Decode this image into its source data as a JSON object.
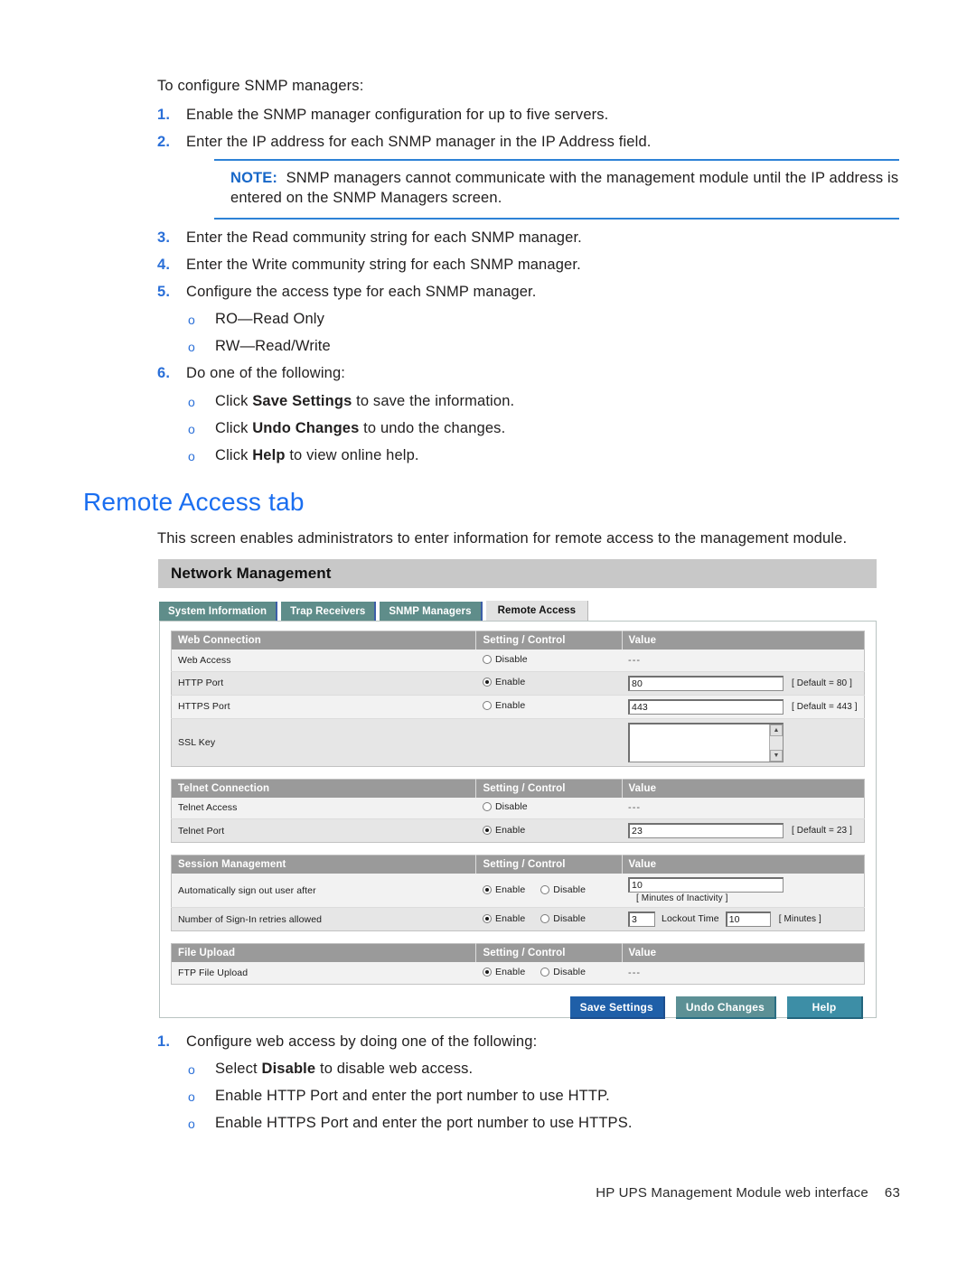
{
  "document": {
    "lead_in": "To configure SNMP managers:",
    "steps_top": [
      {
        "num": "1.",
        "text": "Enable the SNMP manager configuration for up to five servers."
      },
      {
        "num": "2.",
        "text": "Enter the IP address for each SNMP manager in the IP Address field."
      }
    ],
    "note": {
      "label": "NOTE:",
      "text": "SNMP managers cannot communicate with the management module until the IP address is entered on the SNMP Managers screen."
    },
    "steps_mid": [
      {
        "num": "3.",
        "text": "Enter the Read community string for each SNMP manager."
      },
      {
        "num": "4.",
        "text": "Enter the Write community string for each SNMP manager."
      },
      {
        "num": "5.",
        "text": "Configure the access type for each SNMP manager."
      }
    ],
    "access_types": [
      {
        "bullet": "o",
        "text": "RO—Read Only"
      },
      {
        "bullet": "o",
        "text": "RW—Read/Write"
      }
    ],
    "step6": {
      "num": "6.",
      "text": "Do one of the following:"
    },
    "step6_options": [
      {
        "bullet": "o",
        "pre": "Click ",
        "bold": "Save Settings",
        "post": " to save the information."
      },
      {
        "bullet": "o",
        "pre": "Click ",
        "bold": "Undo Changes",
        "post": " to undo the changes."
      },
      {
        "bullet": "o",
        "pre": "Click ",
        "bold": "Help",
        "post": " to view online help."
      }
    ],
    "heading": "Remote Access tab",
    "intro": "This screen enables administrators to enter information for remote access to the management module.",
    "steps_bottom": [
      {
        "num": "1.",
        "text": "Configure web access by doing one of the following:"
      }
    ],
    "bottom_options": [
      {
        "bullet": "o",
        "pre": "Select ",
        "bold": "Disable",
        "post": " to disable web access."
      },
      {
        "bullet": "o",
        "pre": "Enable HTTP Port and enter the port number to use HTTP.",
        "bold": "",
        "post": ""
      },
      {
        "bullet": "o",
        "pre": "Enable HTTPS Port and enter the port number to use HTTPS.",
        "bold": "",
        "post": ""
      }
    ],
    "footer": {
      "text": "HP UPS Management Module web interface",
      "page": "63"
    }
  },
  "screenshot": {
    "app_title": "Network Management",
    "tabs": [
      {
        "label": "System Information",
        "active": false
      },
      {
        "label": "Trap Receivers",
        "active": false
      },
      {
        "label": "SNMP Managers",
        "active": false
      },
      {
        "label": "Remote Access",
        "active": true
      }
    ],
    "common_headers": {
      "setting": "Setting / Control",
      "value": "Value"
    },
    "sections": [
      {
        "title": "Web Connection",
        "rows": [
          {
            "label": "Web Access",
            "controls": [
              {
                "label": "Disable",
                "selected": false
              }
            ],
            "value_kind": "dashes",
            "value": "---"
          },
          {
            "label": "HTTP Port",
            "controls": [
              {
                "label": "Enable",
                "selected": true
              }
            ],
            "value_kind": "input",
            "value": "80",
            "hint": "[ Default = 80 ]"
          },
          {
            "label": "HTTPS Port",
            "controls": [
              {
                "label": "Enable",
                "selected": false
              }
            ],
            "value_kind": "input",
            "value": "443",
            "hint": "[ Default = 443 ]"
          },
          {
            "label": "SSL Key",
            "controls": [],
            "value_kind": "textarea",
            "value": "",
            "hint": ""
          }
        ]
      },
      {
        "title": "Telnet Connection",
        "rows": [
          {
            "label": "Telnet Access",
            "controls": [
              {
                "label": "Disable",
                "selected": false
              }
            ],
            "value_kind": "dashes",
            "value": "---"
          },
          {
            "label": "Telnet Port",
            "controls": [
              {
                "label": "Enable",
                "selected": true
              }
            ],
            "value_kind": "input",
            "value": "23",
            "hint": "[ Default = 23 ]"
          }
        ]
      },
      {
        "title": "Session Management",
        "rows": [
          {
            "label": "Automatically sign out user after",
            "controls": [
              {
                "label": "Enable",
                "selected": true
              },
              {
                "label": "Disable",
                "selected": false
              }
            ],
            "value_kind": "input",
            "value": "10",
            "hint": "[ Minutes of Inactivity ]"
          },
          {
            "label": "Number of Sign-In retries allowed",
            "controls": [
              {
                "label": "Enable",
                "selected": true
              },
              {
                "label": "Disable",
                "selected": false
              }
            ],
            "value_kind": "input_pair",
            "value": "3",
            "mid_label": "Lockout Time",
            "value2": "10",
            "hint": "[ Minutes ]"
          }
        ]
      },
      {
        "title": "File Upload",
        "rows": [
          {
            "label": "FTP File Upload",
            "controls": [
              {
                "label": "Enable",
                "selected": true
              },
              {
                "label": "Disable",
                "selected": false
              }
            ],
            "value_kind": "dashes",
            "value": "---"
          }
        ]
      }
    ],
    "buttons": [
      {
        "label": "Save Settings",
        "style": "btn-save"
      },
      {
        "label": "Undo Changes",
        "style": "btn-undo"
      },
      {
        "label": "Help",
        "style": "btn-help"
      }
    ]
  },
  "colors": {
    "heading_blue": "#1a6ef0",
    "step_number_blue": "#2a6fd8",
    "note_rule_blue": "#2e82d6",
    "tab_teal": "#5f8d8a",
    "table_header_gray": "#9a9a9a",
    "save_button_blue": "#1f5fa8",
    "undo_button_teal": "#5c9095",
    "help_button_teal": "#3d8ea6"
  }
}
